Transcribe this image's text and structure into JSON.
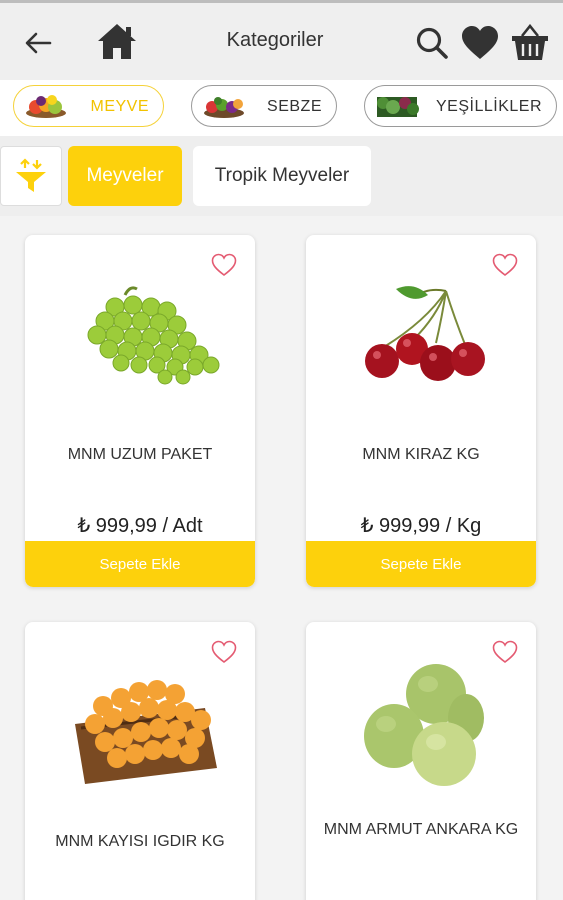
{
  "header": {
    "title": "Kategoriler",
    "back_icon": "arrow-left-icon",
    "home_icon": "home-icon",
    "search_icon": "search-icon",
    "favorites_icon": "heart-icon",
    "cart_icon": "basket-icon"
  },
  "categories": [
    {
      "label": "MEYVE",
      "active": true,
      "icon": "fruit-thumbnail"
    },
    {
      "label": "SEBZE",
      "active": false,
      "icon": "vegetable-thumbnail"
    },
    {
      "label": "YEŞİLLİKLER",
      "active": false,
      "icon": "greens-thumbnail"
    }
  ],
  "subcategories": [
    {
      "label": "Meyveler",
      "active": true
    },
    {
      "label": "Tropik Meyveler",
      "active": false
    }
  ],
  "filter_icon": "filter-funnel-icon",
  "products": [
    {
      "name": "MNM UZUM PAKET",
      "price": "₺ 999,99 / Adt",
      "button": "Sepete Ekle",
      "image": "green-grapes"
    },
    {
      "name": "MNM KIRAZ KG",
      "price": "₺ 999,99 / Kg",
      "button": "Sepete Ekle",
      "image": "cherries"
    },
    {
      "name": "MNM KAYISI IGDIR KG",
      "price": "",
      "button": "",
      "image": "apricot-basket"
    },
    {
      "name": "MNM ARMUT ANKARA KG",
      "price": "",
      "button": "",
      "image": "pears"
    }
  ],
  "colors": {
    "accent": "#fdd10c",
    "heart": "#e45b72"
  }
}
